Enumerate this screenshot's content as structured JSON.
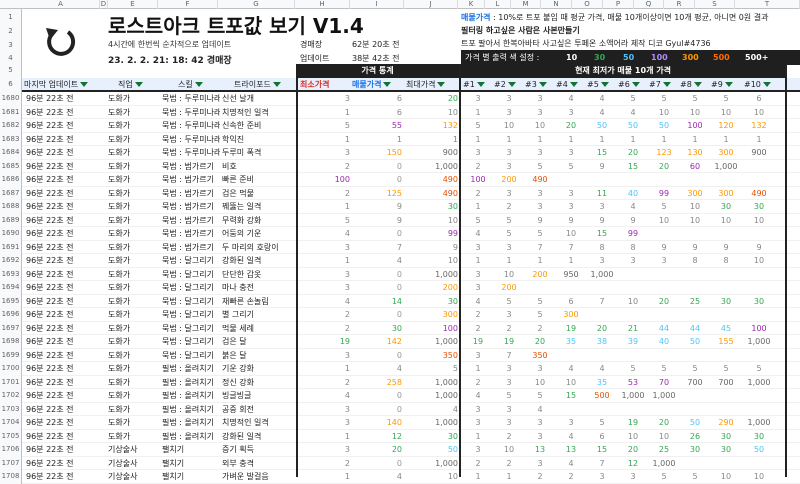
{
  "columns": [
    "A",
    "D",
    "E",
    "F",
    "G",
    "H",
    "I",
    "J",
    "K",
    "L",
    "M",
    "N",
    "O",
    "P",
    "Q",
    "R",
    "S",
    "T"
  ],
  "header": {
    "title": "로스트아크 트포값 보기 V1.4",
    "update_note": "4시간에 한번씩 순차적으로 업데이트",
    "timestamp": "23. 2. 2.  21: 18: 42 경매장",
    "market_label": "경매장",
    "market_value": "62분 20초 전",
    "update_label": "업데이트",
    "update_value": "38분 42초 전",
    "price_label": "매물가격",
    "price_note": ": 10%로 트포 붙임 때 평균 가격, 매물 10개이상이면 10개 평균, 아니면 0원 결과",
    "filter_note": "필터링 하고싶은 사람은 사본만들기",
    "credit": "트포 팔아서 한복아바타 사고싶은 투페온 소액어라 제작   디코 Gyul#4736",
    "color_setting": "가격 별 출력 색 설정 :",
    "stats_header": "가격 통계",
    "listing_header": "현재 최저가 매물 10개 가격",
    "legend": [
      {
        "label": "10",
        "color": "#ffffff"
      },
      {
        "label": "30",
        "color": "#34a853"
      },
      {
        "label": "50",
        "color": "#4fc3f7"
      },
      {
        "label": "100",
        "color": "#b388ff"
      },
      {
        "label": "300",
        "color": "#ff9800"
      },
      {
        "label": "500",
        "color": "#ff6d00"
      },
      {
        "label": "500+",
        "color": "#ffffff"
      }
    ]
  },
  "col_headers": {
    "last_update": "마지막 업데이트",
    "job": "직업",
    "skill": "스킬",
    "tripod": "트라이포드",
    "min": "최소가격",
    "listing": "매물가격",
    "max": "최대가격",
    "n": [
      "#1",
      "#2",
      "#3",
      "#4",
      "#5",
      "#6",
      "#7",
      "#8",
      "#9",
      "#10"
    ]
  },
  "rows": [
    {
      "r": "1680",
      "t": "96분 22초 전",
      "job": "도화가",
      "skill": "묵법 : 두루미나래",
      "trip": "신선 날개",
      "min": "3",
      "avg": "6",
      "max": "20",
      "n": [
        "3",
        "3",
        "3",
        "4",
        "4",
        "5",
        "5",
        "5",
        "5",
        "6"
      ]
    },
    {
      "r": "1681",
      "t": "96분 22초 전",
      "job": "도화가",
      "skill": "묵법 : 두루미나래",
      "trip": "치명적인 일격",
      "min": "1",
      "avg": "6",
      "max": "10",
      "n": [
        "1",
        "3",
        "3",
        "3",
        "4",
        "4",
        "10",
        "10",
        "10",
        "10"
      ]
    },
    {
      "r": "1682",
      "t": "96분 22초 전",
      "job": "도화가",
      "skill": "묵법 : 두루미나래",
      "trip": "신속한 준비",
      "min": "5",
      "avg": "55",
      "max": "132",
      "n": [
        "5",
        "10",
        "10",
        "20",
        "50",
        "50",
        "50",
        "100",
        "120",
        "132"
      ]
    },
    {
      "r": "1683",
      "t": "96분 22초 전",
      "job": "도화가",
      "skill": "묵법 : 두루미나래",
      "trip": "학익진",
      "min": "1",
      "avg": "1",
      "max": "1",
      "n": [
        "1",
        "1",
        "1",
        "1",
        "1",
        "1",
        "1",
        "1",
        "1",
        "1"
      ]
    },
    {
      "r": "1684",
      "t": "96분 22초 전",
      "job": "도화가",
      "skill": "묵법 : 두루미나래",
      "trip": "두루미 폭격",
      "min": "3",
      "avg": "150",
      "max": "900",
      "n": [
        "3",
        "3",
        "3",
        "3",
        "15",
        "20",
        "123",
        "130",
        "300",
        "900"
      ]
    },
    {
      "r": "1685",
      "t": "96분 22초 전",
      "job": "도화가",
      "skill": "묵법 : 범가르기",
      "trip": "비호",
      "min": "2",
      "avg": "0",
      "max": "1,000",
      "n": [
        "2",
        "3",
        "5",
        "5",
        "9",
        "15",
        "20",
        "60",
        "1,000",
        ""
      ]
    },
    {
      "r": "1686",
      "t": "96분 22초 전",
      "job": "도화가",
      "skill": "묵법 : 범가르기",
      "trip": "빠른 준비",
      "min": "100",
      "avg": "0",
      "max": "490",
      "n": [
        "100",
        "200",
        "490",
        "",
        "",
        "",
        "",
        "",
        "",
        ""
      ]
    },
    {
      "r": "1687",
      "t": "96분 22초 전",
      "job": "도화가",
      "skill": "묵법 : 범가르기",
      "trip": "검은 먹물",
      "min": "2",
      "avg": "125",
      "max": "490",
      "n": [
        "2",
        "3",
        "3",
        "3",
        "11",
        "40",
        "99",
        "300",
        "300",
        "490"
      ]
    },
    {
      "r": "1688",
      "t": "96분 22초 전",
      "job": "도화가",
      "skill": "묵법 : 범가르기",
      "trip": "꿰뚫는 일격",
      "min": "1",
      "avg": "9",
      "max": "30",
      "n": [
        "1",
        "2",
        "3",
        "3",
        "3",
        "4",
        "5",
        "10",
        "30",
        "30"
      ]
    },
    {
      "r": "1689",
      "t": "96분 22초 전",
      "job": "도화가",
      "skill": "묵법 : 범가르기",
      "trip": "무력화 강화",
      "min": "5",
      "avg": "9",
      "max": "10",
      "n": [
        "5",
        "5",
        "9",
        "9",
        "9",
        "9",
        "10",
        "10",
        "10",
        "10"
      ]
    },
    {
      "r": "1690",
      "t": "96분 22초 전",
      "job": "도화가",
      "skill": "묵법 : 범가르기",
      "trip": "어둠의 기운",
      "min": "4",
      "avg": "0",
      "max": "99",
      "n": [
        "4",
        "5",
        "5",
        "10",
        "15",
        "99",
        "",
        "",
        "",
        ""
      ]
    },
    {
      "r": "1691",
      "t": "96분 22초 전",
      "job": "도화가",
      "skill": "묵법 : 범가르기",
      "trip": "두 마리의 호랑이",
      "min": "3",
      "avg": "7",
      "max": "9",
      "n": [
        "3",
        "3",
        "7",
        "7",
        "8",
        "8",
        "9",
        "9",
        "9",
        "9"
      ]
    },
    {
      "r": "1692",
      "t": "96분 22초 전",
      "job": "도화가",
      "skill": "묵법 : 달그리기",
      "trip": "강화된 일격",
      "min": "1",
      "avg": "4",
      "max": "10",
      "n": [
        "1",
        "1",
        "1",
        "1",
        "3",
        "3",
        "3",
        "8",
        "8",
        "10"
      ]
    },
    {
      "r": "1693",
      "t": "96분 22초 전",
      "job": "도화가",
      "skill": "묵법 : 달그리기",
      "trip": "단단한 갑옷",
      "min": "3",
      "avg": "0",
      "max": "1,000",
      "n": [
        "3",
        "10",
        "200",
        "950",
        "1,000",
        "",
        "",
        "",
        "",
        ""
      ]
    },
    {
      "r": "1694",
      "t": "96분 22초 전",
      "job": "도화가",
      "skill": "묵법 : 달그리기",
      "trip": "마나 충전",
      "min": "3",
      "avg": "0",
      "max": "200",
      "n": [
        "3",
        "200",
        "",
        "",
        "",
        "",
        "",
        "",
        "",
        ""
      ]
    },
    {
      "r": "1695",
      "t": "96분 22초 전",
      "job": "도화가",
      "skill": "묵법 : 달그리기",
      "trip": "재빠른 손놀림",
      "min": "4",
      "avg": "14",
      "max": "30",
      "n": [
        "4",
        "5",
        "5",
        "6",
        "7",
        "10",
        "20",
        "25",
        "30",
        "30"
      ]
    },
    {
      "r": "1696",
      "t": "96분 22초 전",
      "job": "도화가",
      "skill": "묵법 : 달그리기",
      "trip": "별 그리기",
      "min": "2",
      "avg": "0",
      "max": "300",
      "n": [
        "2",
        "3",
        "5",
        "300",
        "",
        "",
        "",
        "",
        "",
        ""
      ]
    },
    {
      "r": "1697",
      "t": "96분 22초 전",
      "job": "도화가",
      "skill": "묵법 : 달그리기",
      "trip": "먹물 세례",
      "min": "2",
      "avg": "30",
      "max": "100",
      "n": [
        "2",
        "2",
        "2",
        "19",
        "20",
        "21",
        "44",
        "44",
        "45",
        "100"
      ]
    },
    {
      "r": "1698",
      "t": "96분 22초 전",
      "job": "도화가",
      "skill": "묵법 : 달그리기",
      "trip": "검은 달",
      "min": "19",
      "avg": "142",
      "max": "1,000",
      "n": [
        "19",
        "19",
        "20",
        "35",
        "38",
        "39",
        "40",
        "50",
        "155",
        "1,000"
      ]
    },
    {
      "r": "1699",
      "t": "96분 22초 전",
      "job": "도화가",
      "skill": "묵법 : 달그리기",
      "trip": "붉은 달",
      "min": "3",
      "avg": "0",
      "max": "350",
      "n": [
        "3",
        "7",
        "350",
        "",
        "",
        "",
        "",
        "",
        "",
        ""
      ]
    },
    {
      "r": "1700",
      "t": "96분 22초 전",
      "job": "도화가",
      "skill": "필법 : 올려치기",
      "trip": "기운 강화",
      "min": "1",
      "avg": "4",
      "max": "5",
      "n": [
        "1",
        "3",
        "3",
        "4",
        "4",
        "5",
        "5",
        "5",
        "5",
        "5"
      ]
    },
    {
      "r": "1701",
      "t": "96분 22초 전",
      "job": "도화가",
      "skill": "필법 : 올려치기",
      "trip": "정신 강화",
      "min": "2",
      "avg": "258",
      "max": "1,000",
      "n": [
        "2",
        "3",
        "10",
        "10",
        "35",
        "53",
        "70",
        "700",
        "700",
        "1,000"
      ]
    },
    {
      "r": "1702",
      "t": "96분 22초 전",
      "job": "도화가",
      "skill": "필법 : 올려치기",
      "trip": "빙글빙글",
      "min": "4",
      "avg": "0",
      "max": "1,000",
      "n": [
        "4",
        "5",
        "5",
        "15",
        "500",
        "1,000",
        "1,000",
        "",
        "",
        ""
      ]
    },
    {
      "r": "1703",
      "t": "96분 22초 전",
      "job": "도화가",
      "skill": "필법 : 올려치기",
      "trip": "공중 회전",
      "min": "3",
      "avg": "0",
      "max": "4",
      "n": [
        "3",
        "3",
        "4",
        "",
        "",
        "",
        "",
        "",
        "",
        ""
      ]
    },
    {
      "r": "1704",
      "t": "96분 22초 전",
      "job": "도화가",
      "skill": "필법 : 올려치기",
      "trip": "치명적인 일격",
      "min": "3",
      "avg": "140",
      "max": "1,000",
      "n": [
        "3",
        "3",
        "3",
        "3",
        "5",
        "19",
        "20",
        "50",
        "290",
        "1,000"
      ]
    },
    {
      "r": "1705",
      "t": "96분 22초 전",
      "job": "도화가",
      "skill": "필법 : 올려치기",
      "trip": "강화된 일격",
      "min": "1",
      "avg": "12",
      "max": "30",
      "n": [
        "1",
        "2",
        "3",
        "4",
        "6",
        "10",
        "10",
        "26",
        "30",
        "30"
      ]
    },
    {
      "r": "1706",
      "t": "96분 22초 전",
      "job": "기상술사",
      "skill": "팰치기",
      "trip": "증기 획득",
      "min": "3",
      "avg": "20",
      "max": "50",
      "n": [
        "3",
        "10",
        "13",
        "13",
        "15",
        "20",
        "25",
        "30",
        "30",
        "50"
      ]
    },
    {
      "r": "1707",
      "t": "96분 22초 전",
      "job": "기상술사",
      "skill": "팰치기",
      "trip": "외부 충격",
      "min": "2",
      "avg": "0",
      "max": "1,000",
      "n": [
        "2",
        "2",
        "3",
        "4",
        "7",
        "12",
        "1,000",
        "",
        "",
        ""
      ]
    },
    {
      "r": "1708",
      "t": "96분 22초 전",
      "job": "기상술사",
      "skill": "팰치기",
      "trip": "가벼운 발걸음",
      "min": "1",
      "avg": "4",
      "max": "10",
      "n": [
        "1",
        "1",
        "2",
        "2",
        "3",
        "3",
        "5",
        "5",
        "10",
        "10"
      ]
    }
  ]
}
